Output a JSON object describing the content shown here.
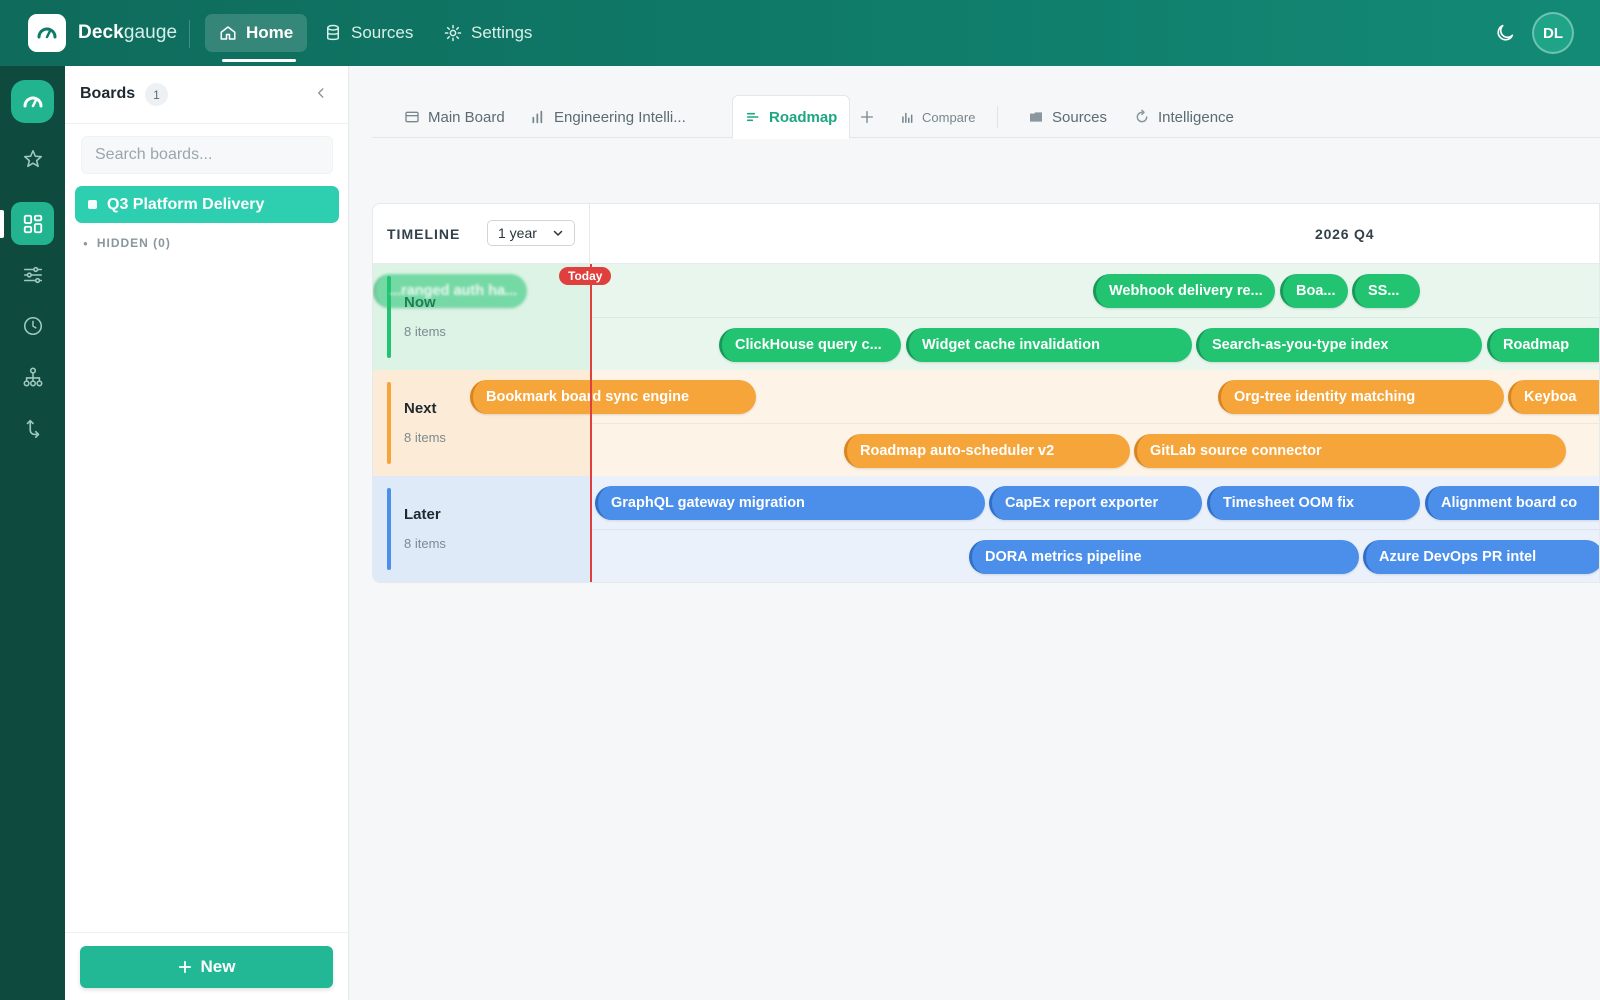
{
  "app": {
    "brand_bold": "Deck",
    "brand_light": "gauge",
    "nav": [
      {
        "label": "Home",
        "icon": "home-icon",
        "active": true
      },
      {
        "label": "Sources",
        "icon": "database-icon",
        "active": false
      },
      {
        "label": "Settings",
        "icon": "gear-icon",
        "active": false
      }
    ],
    "user_initials": "DL"
  },
  "rail": {
    "icons": [
      "deckgauge-logo-icon",
      "star-icon",
      "dashboard-grid-icon",
      "sliders-icon",
      "clock-icon",
      "org-tree-icon",
      "return-arrow-icon"
    ],
    "active": "dashboard-grid-icon"
  },
  "boards_panel": {
    "title": "Boards",
    "count": "1",
    "search_placeholder": "Search boards...",
    "boards": [
      {
        "name": "Q3 Platform Delivery",
        "selected": true
      }
    ],
    "hidden_label": "HIDDEN (0)",
    "new_label": "New"
  },
  "tabs": [
    {
      "label": "Main Board",
      "icon": "board-icon"
    },
    {
      "label": "Engineering Intelli...",
      "icon": "bar-chart-icon"
    },
    {
      "label": "Roadmap",
      "icon": "roadmap-icon",
      "active": true
    },
    {
      "label": "Compare",
      "icon": "compare-icon"
    },
    {
      "label": "Sources",
      "icon": "folder-icon"
    },
    {
      "label": "Intelligence",
      "icon": "intelligence-icon"
    }
  ],
  "timeline": {
    "label": "TIMELINE",
    "range": "1 year",
    "range_options": [
      "1 year"
    ],
    "quarter": "2026 Q4",
    "today_label": "Today",
    "lanes": [
      {
        "name": "Now",
        "count": "8 items",
        "color": "#22c472",
        "rows": [
          [
            "Webhook delivery re...",
            "Boa...",
            "SS..."
          ],
          [
            "ClickHouse query c...",
            "Widget cache invalidation",
            "Search-as-you-type index",
            "Roadmap"
          ]
        ],
        "ghost": "...ranged auth ha..."
      },
      {
        "name": "Next",
        "count": "8 items",
        "color": "#f5a53a",
        "rows": [
          [
            "Bookmark board sync engine",
            "Org-tree identity matching",
            "Keyboa"
          ],
          [
            "Roadmap auto-scheduler v2",
            "GitLab source connector"
          ]
        ]
      },
      {
        "name": "Later",
        "count": "8 items",
        "color": "#4b8fea",
        "rows": [
          [
            "GraphQL gateway migration",
            "CapEx report exporter",
            "Timesheet OOM fix",
            "Alignment board co"
          ],
          [
            "DORA metrics pipeline",
            "Azure DevOps PR intel"
          ]
        ]
      }
    ]
  },
  "colors": {
    "topbar": "#0f7a68",
    "rail": "#0f4a3f",
    "accent": "#22b795",
    "today": "#e0403d"
  }
}
